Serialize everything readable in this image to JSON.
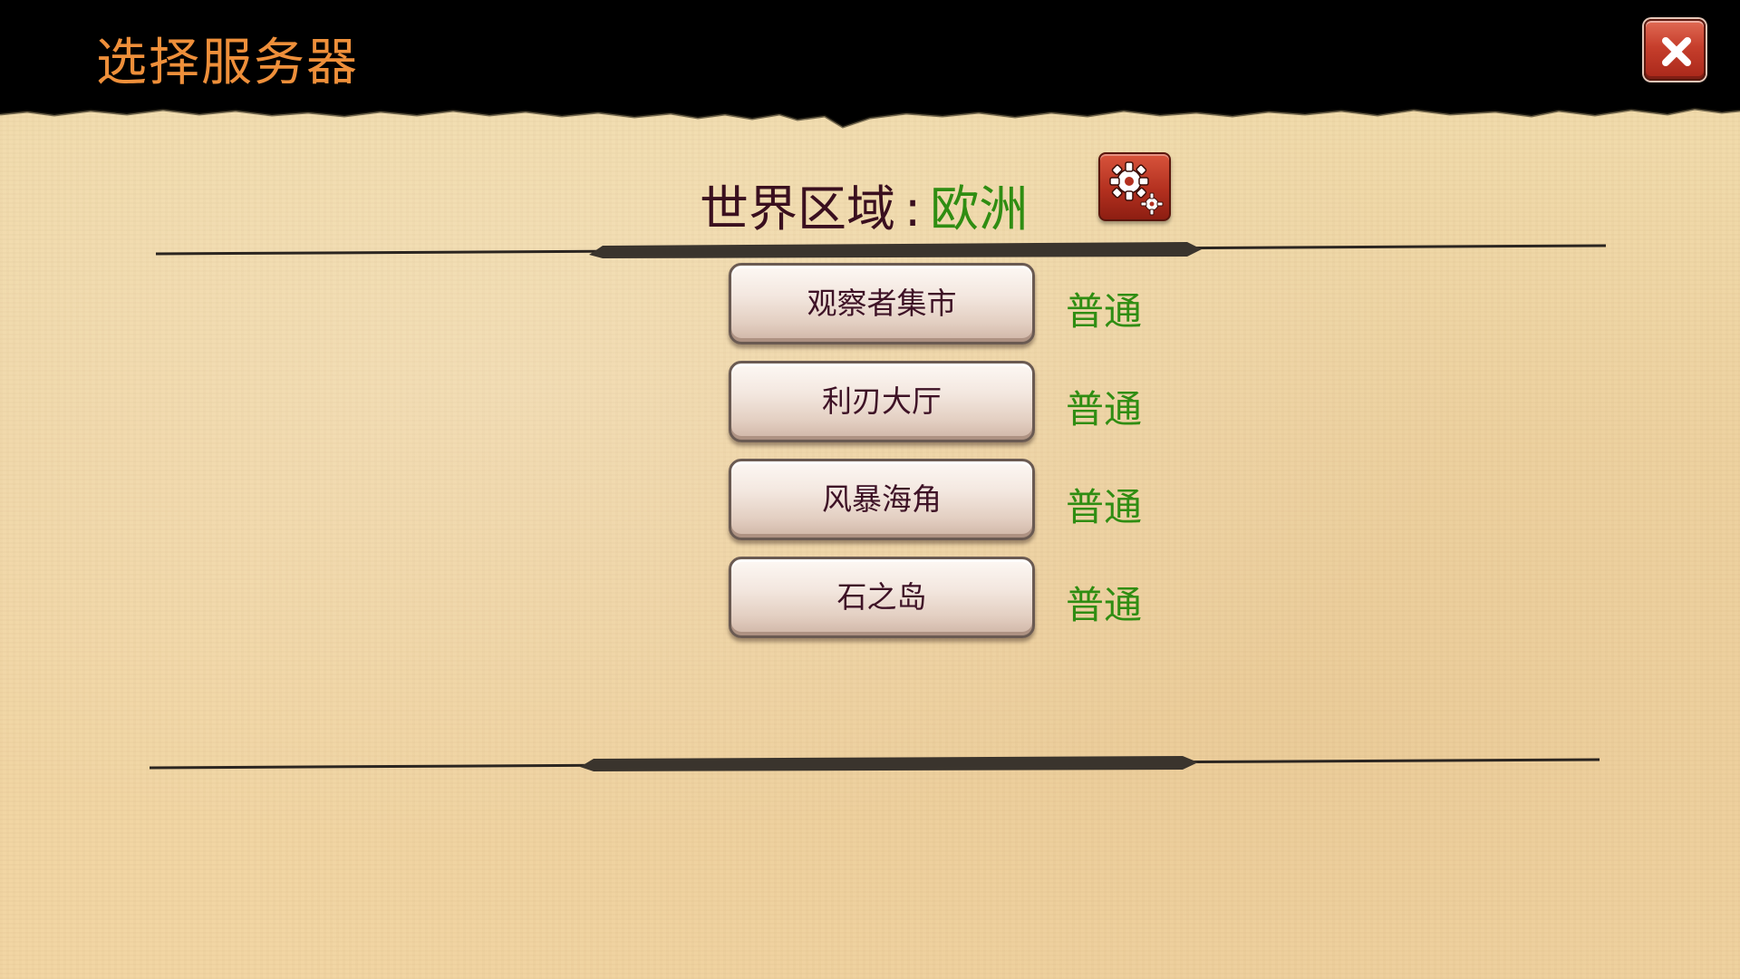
{
  "header": {
    "title": "选择服务器"
  },
  "region": {
    "label": "世界区域",
    "separator": ":",
    "value": "欧洲"
  },
  "servers": [
    {
      "name": "观察者集市",
      "status": "普通"
    },
    {
      "name": "利刃大厅",
      "status": "普通"
    },
    {
      "name": "风暴海角",
      "status": "普通"
    },
    {
      "name": "石之岛",
      "status": "普通"
    }
  ],
  "colors": {
    "title": "#ee8f3a",
    "region_label": "#3a0f1f",
    "region_value": "#2f8d12",
    "status": "#2f8d12",
    "button_text": "#3e1226",
    "close_button": "#c63e2c"
  },
  "icons": {
    "close": "close-icon",
    "settings": "gear-icon"
  }
}
